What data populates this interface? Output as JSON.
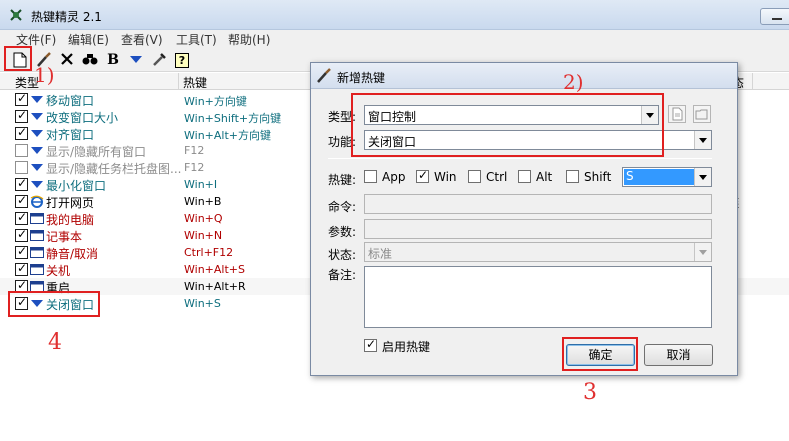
{
  "window": {
    "title": "热键精灵 2.1"
  },
  "menu": [
    "文件(F)",
    "编辑(E)",
    "查看(V)",
    "工具(T)",
    "帮助(H)"
  ],
  "toolbar": {
    "buttons": [
      "new-icon",
      "brush-icon",
      "delete-icon",
      "find-icon",
      "bold-icon",
      "down-arrow-icon",
      "tools-icon",
      "help-icon"
    ],
    "bold_label": "B",
    "help_label": "?"
  },
  "list": {
    "columns": [
      "类型",
      "热键"
    ],
    "right_fragment": "态",
    "rows": [
      {
        "name": "移动窗口",
        "key": "Win+方向键",
        "checked": true,
        "icon": "arrow-down-icon",
        "color": "#0e6e7e"
      },
      {
        "name": "改变窗口大小",
        "key": "Win+Shift+方向键",
        "checked": true,
        "icon": "arrow-down-icon",
        "color": "#0e6e7e"
      },
      {
        "name": "对齐窗口",
        "key": "Win+Alt+方向键",
        "checked": true,
        "icon": "arrow-down-icon",
        "color": "#0e6e7e"
      },
      {
        "name": "显示/隐藏所有窗口",
        "key": "F12",
        "checked": false,
        "icon": "arrow-down-icon",
        "color": "#8c8c8c"
      },
      {
        "name": "显示/隐藏任务栏托盘图...",
        "key": "F12",
        "checked": false,
        "icon": "arrow-down-icon",
        "color": "#8c8c8c"
      },
      {
        "name": "最小化窗口",
        "key": "Win+I",
        "checked": true,
        "icon": "arrow-down-icon",
        "color": "#0e6e7e"
      },
      {
        "name": "打开网页",
        "key": "Win+B",
        "checked": true,
        "icon": "ie-icon",
        "color": "#000000",
        "extra": "链"
      },
      {
        "name": "我的电脑",
        "key": "Win+Q",
        "checked": true,
        "icon": "window-icon",
        "color": "#b00000"
      },
      {
        "name": "记事本",
        "key": "Win+N",
        "checked": true,
        "icon": "window-icon",
        "color": "#b00000"
      },
      {
        "name": "静音/取消",
        "key": "Ctrl+F12",
        "checked": true,
        "icon": "window-icon",
        "color": "#b00000"
      },
      {
        "name": "关机",
        "key": "Win+Alt+S",
        "checked": true,
        "icon": "window-icon",
        "color": "#b00000"
      },
      {
        "name": "重启",
        "key": "Win+Alt+R",
        "checked": true,
        "icon": "window-icon",
        "color": "#000000"
      },
      {
        "name": "关闭窗口",
        "key": "Win+S",
        "checked": true,
        "icon": "arrow-down-icon",
        "color": "#0e6e7e"
      }
    ]
  },
  "annotations": {
    "step1": "1)",
    "step2": "2)",
    "step3": "3",
    "step4": "4"
  },
  "dialog": {
    "title": "新增热键",
    "type_label": "类型:",
    "type_value": "窗口控制",
    "func_label": "功能:",
    "func_value": "关闭窗口",
    "hotkey_label": "热键:",
    "modifiers": [
      {
        "label": "App",
        "checked": false
      },
      {
        "label": "Win",
        "checked": true
      },
      {
        "label": "Ctrl",
        "checked": false
      },
      {
        "label": "Alt",
        "checked": false
      },
      {
        "label": "Shift",
        "checked": false
      }
    ],
    "key_value": "S",
    "command_label": "命令:",
    "params_label": "参数:",
    "state_label": "状态:",
    "state_value": "标准",
    "note_label": "备注:",
    "enable_label": "启用热键",
    "enable_checked": true,
    "ok_label": "确定",
    "cancel_label": "取消"
  }
}
